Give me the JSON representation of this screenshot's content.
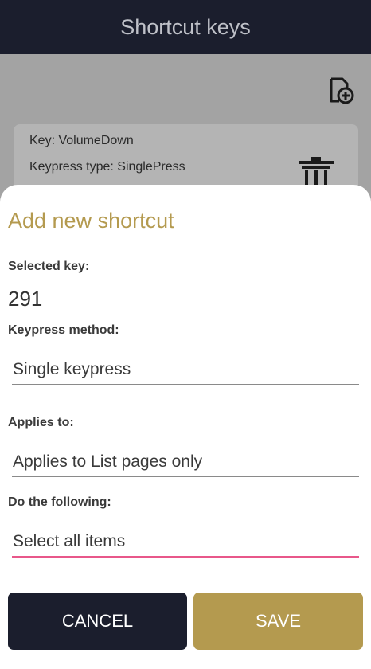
{
  "header": {
    "title": "Shortcut keys"
  },
  "toolbar": {
    "add_icon": "add-document-icon"
  },
  "shortcut_card": {
    "key_line": "Key:  VolumeDown",
    "keypress_line": "Keypress type:  SinglePress",
    "delete_icon": "trash-icon"
  },
  "dialog": {
    "title": "Add new shortcut",
    "selected_key_label": "Selected key:",
    "selected_key_value": "291",
    "keypress_method_label": "Keypress method:",
    "keypress_method_value": "Single keypress",
    "applies_to_label": "Applies to:",
    "applies_to_value": "Applies to List pages only",
    "action_label": "Do the following:",
    "action_value": "Select all items",
    "cancel_label": "CANCEL",
    "save_label": "SAVE"
  },
  "colors": {
    "app_bar": "#1b1e2d",
    "accent_gold": "#b49a4f",
    "active_underline": "#e8578a",
    "scrim": "#a3a3a3"
  }
}
